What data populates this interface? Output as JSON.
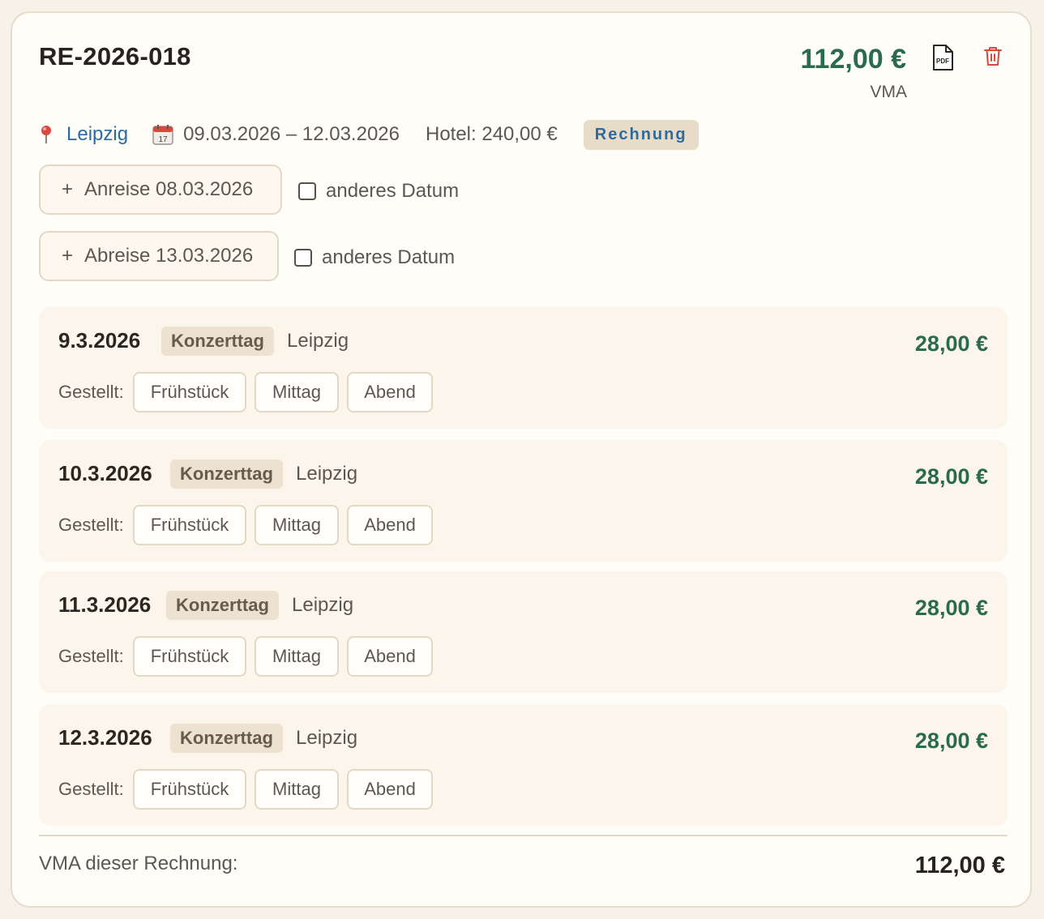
{
  "invoice": {
    "number": "RE-2026-018",
    "total": "112,00 €",
    "total_caption": "VMA",
    "pdf_icon_text": "PDF"
  },
  "meta": {
    "city": "Leipzig",
    "date_range": "09.03.2026 – 12.03.2026",
    "hotel": "Hotel: 240,00 €",
    "badge": "Rechnung",
    "calendar_icon_text": "17"
  },
  "travel": {
    "arrival": {
      "label": "Anreise 08.03.2026",
      "alt_label": "anderes Datum",
      "checked": false
    },
    "departure": {
      "label": "Abreise 13.03.2026",
      "alt_label": "anderes Datum",
      "checked": false
    },
    "plus": "+"
  },
  "days": [
    {
      "date": "9.3.2026",
      "tag": "Konzerttag",
      "place": "Leipzig",
      "amount": "28,00 €",
      "gestellt": "Gestellt:",
      "meals": [
        "Frühstück",
        "Mittag",
        "Abend"
      ]
    },
    {
      "date": "10.3.2026",
      "tag": "Konzerttag",
      "place": "Leipzig",
      "amount": "28,00 €",
      "gestellt": "Gestellt:",
      "meals": [
        "Frühstück",
        "Mittag",
        "Abend"
      ]
    },
    {
      "date": "11.3.2026",
      "tag": "Konzerttag",
      "place": "Leipzig",
      "amount": "28,00 €",
      "gestellt": "Gestellt:",
      "meals": [
        "Frühstück",
        "Mittag",
        "Abend"
      ]
    },
    {
      "date": "12.3.2026",
      "tag": "Konzerttag",
      "place": "Leipzig",
      "amount": "28,00 €",
      "gestellt": "Gestellt:",
      "meals": [
        "Frühstück",
        "Mittag",
        "Abend"
      ]
    }
  ],
  "footer": {
    "label": "VMA dieser Rechnung:",
    "total": "112,00 €"
  },
  "colors": {
    "amount_green": "#2a6b4c",
    "link_blue": "#2d6a9f",
    "delete_red": "#d9473f",
    "card_border": "#e7ddcc"
  }
}
